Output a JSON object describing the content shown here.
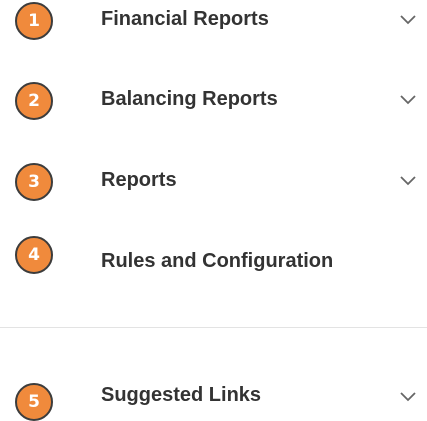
{
  "menu": {
    "items": [
      {
        "number": "1",
        "label": "Financial Reports",
        "has_chevron": true
      },
      {
        "number": "2",
        "label": "Balancing Reports",
        "has_chevron": true
      },
      {
        "number": "3",
        "label": "Reports",
        "has_chevron": true
      },
      {
        "number": "4",
        "label": "Rules and Configuration",
        "has_chevron": false
      }
    ],
    "suggested": {
      "number": "5",
      "label": "Suggested Links",
      "has_chevron": true
    }
  },
  "colors": {
    "badge_fill": "#f08a3c",
    "badge_border": "#3c3c3c",
    "label_text": "#333333",
    "chevron": "#666666",
    "divider": "#e3e3e3"
  },
  "icons": {
    "badge": "numbered-circle",
    "expand": "chevron-down-icon"
  }
}
